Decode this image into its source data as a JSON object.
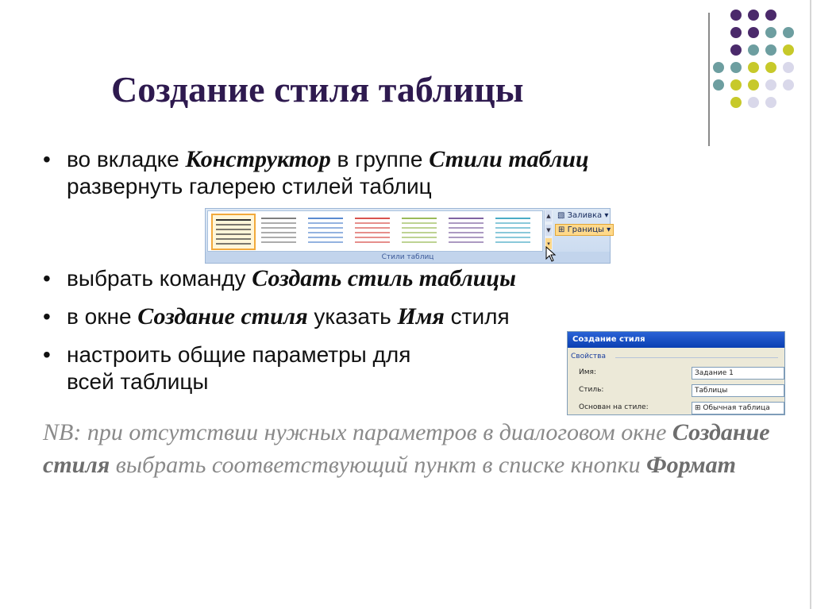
{
  "title": "Создание стиля таблицы",
  "bullet_marker": "•",
  "bullets": {
    "b1": {
      "pre": "во вкладке ",
      "bold1": "Конструктор",
      "mid": " в группе ",
      "bold2": "Стили таблиц",
      "line2": "развернуть галерею стилей таблиц"
    },
    "b2": {
      "pre": "выбрать команду ",
      "bold": "Создать стиль таблицы"
    },
    "b3": {
      "pre": "в окне ",
      "bold1": "Создание стиля",
      "mid": " указать ",
      "bold2": "Имя",
      "post": " стиля"
    },
    "b4": {
      "line1": "настроить  общие параметры для",
      "line2": "всей таблицы"
    }
  },
  "nb": {
    "part1": "NB: при отсутствии нужных параметров в диалоговом окне ",
    "bold1": "Создание стиля",
    "part2": " выбрать соответствующий пункт в списке кнопки ",
    "bold2": "Формат"
  },
  "ribbon": {
    "fill_label": "Заливка",
    "borders_label": "Границы",
    "group_label": "Стили таблиц",
    "thumbnail_colors": [
      "#333333",
      "#7f7f7f",
      "#5b8bd0",
      "#d9534f",
      "#9bbb59",
      "#8064a2",
      "#4bacc6"
    ]
  },
  "dialog": {
    "title": "Создание стиля",
    "group": "Свойства",
    "name_label": "Имя:",
    "name_value": "Задание 1",
    "type_label": "Стиль:",
    "type_value": "Таблицы",
    "based_label": "Основан на стиле:",
    "based_value": "Обычная таблица"
  },
  "colors": {
    "title": "#2e1a4f",
    "dot_purple": "#4b2a6b",
    "dot_teal": "#6d9ea0",
    "dot_olive": "#c7c92a",
    "dot_lavender": "#d9d8ea"
  }
}
